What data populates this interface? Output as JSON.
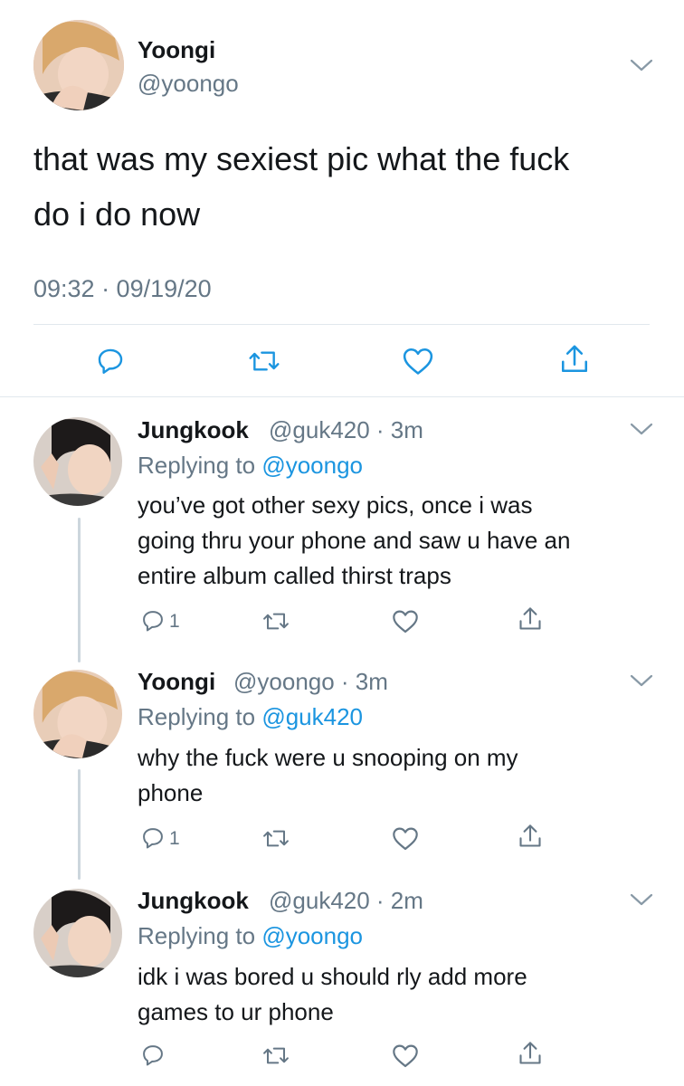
{
  "main_tweet": {
    "author_name": "Yoongi",
    "author_handle": "@yoongo",
    "text_line1": "that was my sexiest pic what the fuck",
    "text_line2": "do i do now",
    "timestamp": "09:32 · 09/19/20"
  },
  "replies": [
    {
      "author_name": "Jungkook",
      "handle_time": "@guk420 · 3m",
      "replying_prefix": "Replying to",
      "replying_to": "@yoongo",
      "lines": [
        "you’ve got other sexy pics, once i was",
        "going thru your phone and saw u have an",
        "entire album called thirst traps"
      ],
      "reply_count": "1"
    },
    {
      "author_name": "Yoongi",
      "handle_time": "@yoongo · 3m",
      "replying_prefix": "Replying to",
      "replying_to": "@guk420",
      "lines": [
        "why the fuck were u snooping on my",
        "phone"
      ],
      "reply_count": "1"
    },
    {
      "author_name": "Jungkook",
      "handle_time": "@guk420 · 2m",
      "replying_prefix": "Replying to",
      "replying_to": "@yoongo",
      "lines": [
        "idk i was bored u should rly add more",
        "games to ur phone"
      ],
      "reply_count": ""
    }
  ],
  "icons": {
    "reply": "reply-icon",
    "retweet": "retweet-icon",
    "like": "heart-icon",
    "share": "share-icon",
    "more": "chevron-down-icon"
  },
  "colors": {
    "text": "#14171a",
    "muted": "#657786",
    "link": "#1b95e0",
    "divider": "#e1e8ed",
    "thread": "#ccd6dd"
  }
}
